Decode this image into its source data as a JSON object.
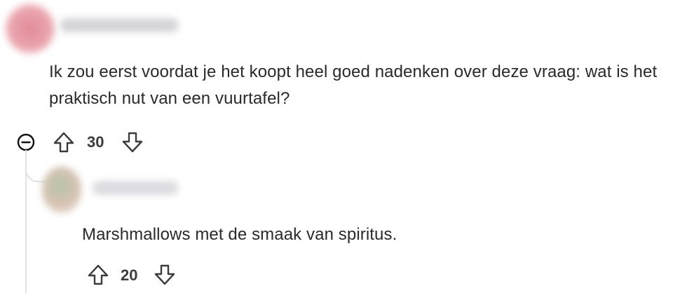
{
  "comments": [
    {
      "username": "",
      "text": "Ik zou eerst voordat je het koopt heel goed nadenken over deze vraag: wat is het praktisch nut van een vuurtafel?",
      "score": "30"
    },
    {
      "username": "",
      "text": "Marshmallows met de smaak van spiritus.",
      "score": "20"
    }
  ],
  "icons": {
    "collapse": "minus-circle-icon",
    "upvote": "arrow-up-icon",
    "downvote": "arrow-down-icon"
  },
  "colors": {
    "text": "#2a2a2a",
    "icon": "#3c3c3c",
    "thread_line": "#e1e1e6"
  }
}
